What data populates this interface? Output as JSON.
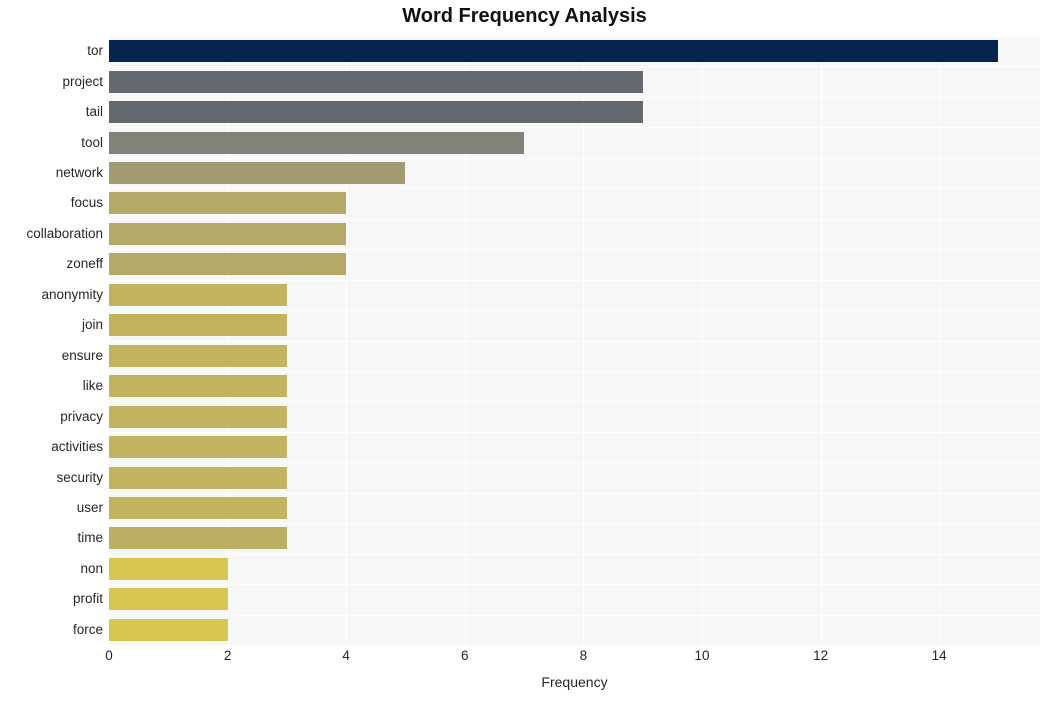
{
  "chart_data": {
    "type": "bar",
    "orientation": "horizontal",
    "title": "Word Frequency Analysis",
    "xlabel": "Frequency",
    "ylabel": "",
    "xlim": [
      0,
      15.7
    ],
    "ylim": [
      0,
      20
    ],
    "xticks": [
      0,
      2,
      4,
      6,
      8,
      10,
      12,
      14
    ],
    "xticklabels": [
      "0",
      "2",
      "4",
      "6",
      "8",
      "10",
      "12",
      "14"
    ],
    "grid": true,
    "grid_color": "#ffffff",
    "plot_background": "#f7f7f7",
    "figure_background": "#ffffff",
    "legend": null,
    "categories": [
      "tor",
      "project",
      "tail",
      "tool",
      "network",
      "focus",
      "collaboration",
      "zoneff",
      "anonymity",
      "join",
      "ensure",
      "like",
      "privacy",
      "activities",
      "security",
      "user",
      "time",
      "non",
      "profit",
      "force"
    ],
    "values": [
      15,
      9,
      9,
      7,
      5,
      4,
      4,
      4,
      3,
      3,
      3,
      3,
      3,
      3,
      3,
      3,
      3,
      2,
      2,
      2
    ],
    "bar_colors": [
      "#062450",
      "#646872",
      "#64686f",
      "#838278",
      "#a29a70",
      "#b5a967",
      "#b5a967",
      "#b5a967",
      "#c2b35f",
      "#c2b35f",
      "#c2b35f",
      "#c2b35f",
      "#c2b35f",
      "#c2b35f",
      "#c2b35f",
      "#c2b35f",
      "#bdaf62",
      "#d9c552",
      "#d9c552",
      "#d9c552"
    ]
  }
}
